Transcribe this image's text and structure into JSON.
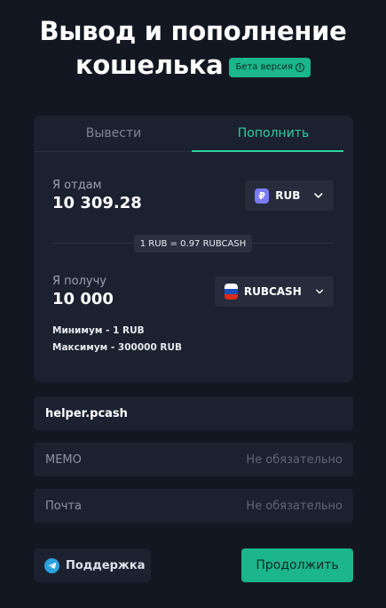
{
  "header": {
    "title_line1": "Вывод и пополнение",
    "title_line2": "кошелька",
    "beta_label": "Бета версия"
  },
  "tabs": [
    {
      "label": "Вывести",
      "active": false
    },
    {
      "label": "Пополнить",
      "active": true
    }
  ],
  "give": {
    "label": "Я отдам",
    "amount": "10 309.28",
    "currency": "RUB",
    "currency_icon": "ruble-icon"
  },
  "rate": "1 RUB = 0.97 RUBCASH",
  "receive": {
    "label": "Я получу",
    "amount": "10 000",
    "currency": "RUBCASH",
    "currency_icon": "russia-flag-icon"
  },
  "limits": {
    "min": "Минимум - 1 RUB",
    "max": "Максимум - 300000 RUB"
  },
  "fields": {
    "account_value": "helper.pcash",
    "memo_label": "MEMO",
    "memo_placeholder": "Не обязательно",
    "email_label": "Почта",
    "email_placeholder": "Не обязательно"
  },
  "buttons": {
    "support": "Поддержка",
    "continue": "Продолжить"
  },
  "colors": {
    "background": "#131722",
    "card": "#1c2130",
    "accent": "#1bb68b",
    "accent_text": "#2ed1a2",
    "ruble_icon": "#7b7cf5",
    "telegram": "#2aa1e0"
  }
}
